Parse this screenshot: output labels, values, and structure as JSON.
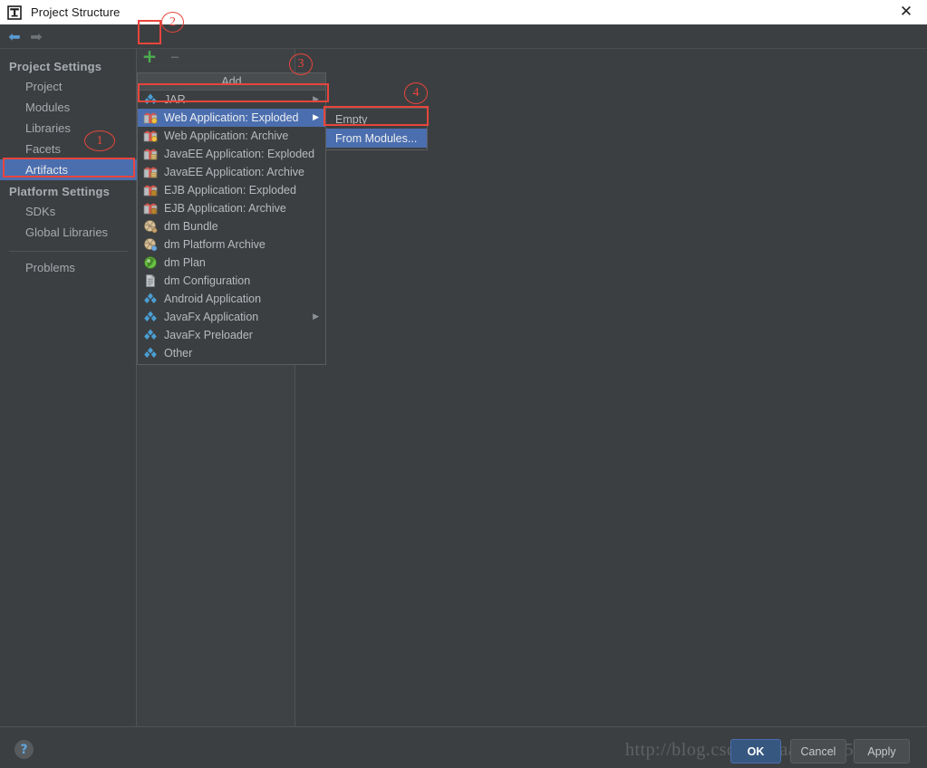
{
  "window": {
    "title": "Project Structure",
    "app_icon": "intellij-idea-icon",
    "close_label": "✕"
  },
  "toolbar": {
    "back_icon": "arrow-left-icon",
    "forward_icon": "arrow-right-icon",
    "add_label": "+",
    "remove_label": "–"
  },
  "sidebar": {
    "groups": [
      {
        "title": "Project Settings",
        "items": [
          {
            "label": "Project",
            "selected": false
          },
          {
            "label": "Modules",
            "selected": false
          },
          {
            "label": "Libraries",
            "selected": false
          },
          {
            "label": "Facets",
            "selected": false
          },
          {
            "label": "Artifacts",
            "selected": true
          }
        ]
      },
      {
        "title": "Platform Settings",
        "items": [
          {
            "label": "SDKs",
            "selected": false
          },
          {
            "label": "Global Libraries",
            "selected": false
          }
        ]
      }
    ],
    "problems_label": "Problems"
  },
  "add_menu": {
    "header": "Add",
    "items": [
      {
        "label": "JAR",
        "icon": "diamond-icon",
        "icon_color": "#4a9fd4",
        "arrow": true,
        "highlight": false
      },
      {
        "label": "Web Application: Exploded",
        "icon": "package-web-icon",
        "icon_color": "#d4564e",
        "arrow": true,
        "highlight": true
      },
      {
        "label": "Web Application: Archive",
        "icon": "package-web-icon",
        "icon_color": "#d4564e",
        "arrow": false,
        "highlight": false
      },
      {
        "label": "JavaEE Application: Exploded",
        "icon": "package-ee-icon",
        "icon_color": "#d4564e",
        "arrow": false,
        "highlight": false
      },
      {
        "label": "JavaEE Application: Archive",
        "icon": "package-ee-icon",
        "icon_color": "#d4564e",
        "arrow": false,
        "highlight": false
      },
      {
        "label": "EJB Application: Exploded",
        "icon": "package-ejb-icon",
        "icon_color": "#d4564e",
        "arrow": false,
        "highlight": false
      },
      {
        "label": "EJB Application: Archive",
        "icon": "package-ejb-icon",
        "icon_color": "#d4564e",
        "arrow": false,
        "highlight": false
      },
      {
        "label": "dm Bundle",
        "icon": "bundle-icon",
        "icon_color": "#c8a06a",
        "arrow": false,
        "highlight": false
      },
      {
        "label": "dm Platform Archive",
        "icon": "bundle-icon",
        "icon_color": "#c8a06a",
        "arrow": false,
        "highlight": false
      },
      {
        "label": "dm Plan",
        "icon": "globe-icon",
        "icon_color": "#6bbf43",
        "arrow": false,
        "highlight": false
      },
      {
        "label": "dm Configuration",
        "icon": "document-icon",
        "icon_color": "#9aa0a6",
        "arrow": false,
        "highlight": false
      },
      {
        "label": "Android Application",
        "icon": "diamond-icon",
        "icon_color": "#4a9fd4",
        "arrow": false,
        "highlight": false
      },
      {
        "label": "JavaFx Application",
        "icon": "diamond-icon",
        "icon_color": "#4a9fd4",
        "arrow": true,
        "highlight": false
      },
      {
        "label": "JavaFx Preloader",
        "icon": "diamond-icon",
        "icon_color": "#4a9fd4",
        "arrow": false,
        "highlight": false
      },
      {
        "label": "Other",
        "icon": "diamond-icon",
        "icon_color": "#4a9fd4",
        "arrow": false,
        "highlight": false
      }
    ]
  },
  "submenu": {
    "items": [
      {
        "label": "Empty",
        "highlight": false
      },
      {
        "label": "From Modules...",
        "highlight": true
      }
    ]
  },
  "footer": {
    "help_label": "?",
    "ok_label": "OK",
    "cancel_label": "Cancel",
    "apply_label": "Apply"
  },
  "watermark": "http://blog.csdn.net/aa_37045414",
  "annotations": [
    {
      "number": "1",
      "target": "artifacts-sidebar-item"
    },
    {
      "number": "2",
      "target": "add-button"
    },
    {
      "number": "3",
      "target": "web-application-exploded-menu-item"
    },
    {
      "number": "4",
      "target": "from-modules-submenu-item"
    }
  ],
  "colors": {
    "accent_selection": "#4b6eaf",
    "annotation_red": "#e8453c",
    "window_bg": "#3c3f41",
    "add_green": "#4caf50"
  }
}
